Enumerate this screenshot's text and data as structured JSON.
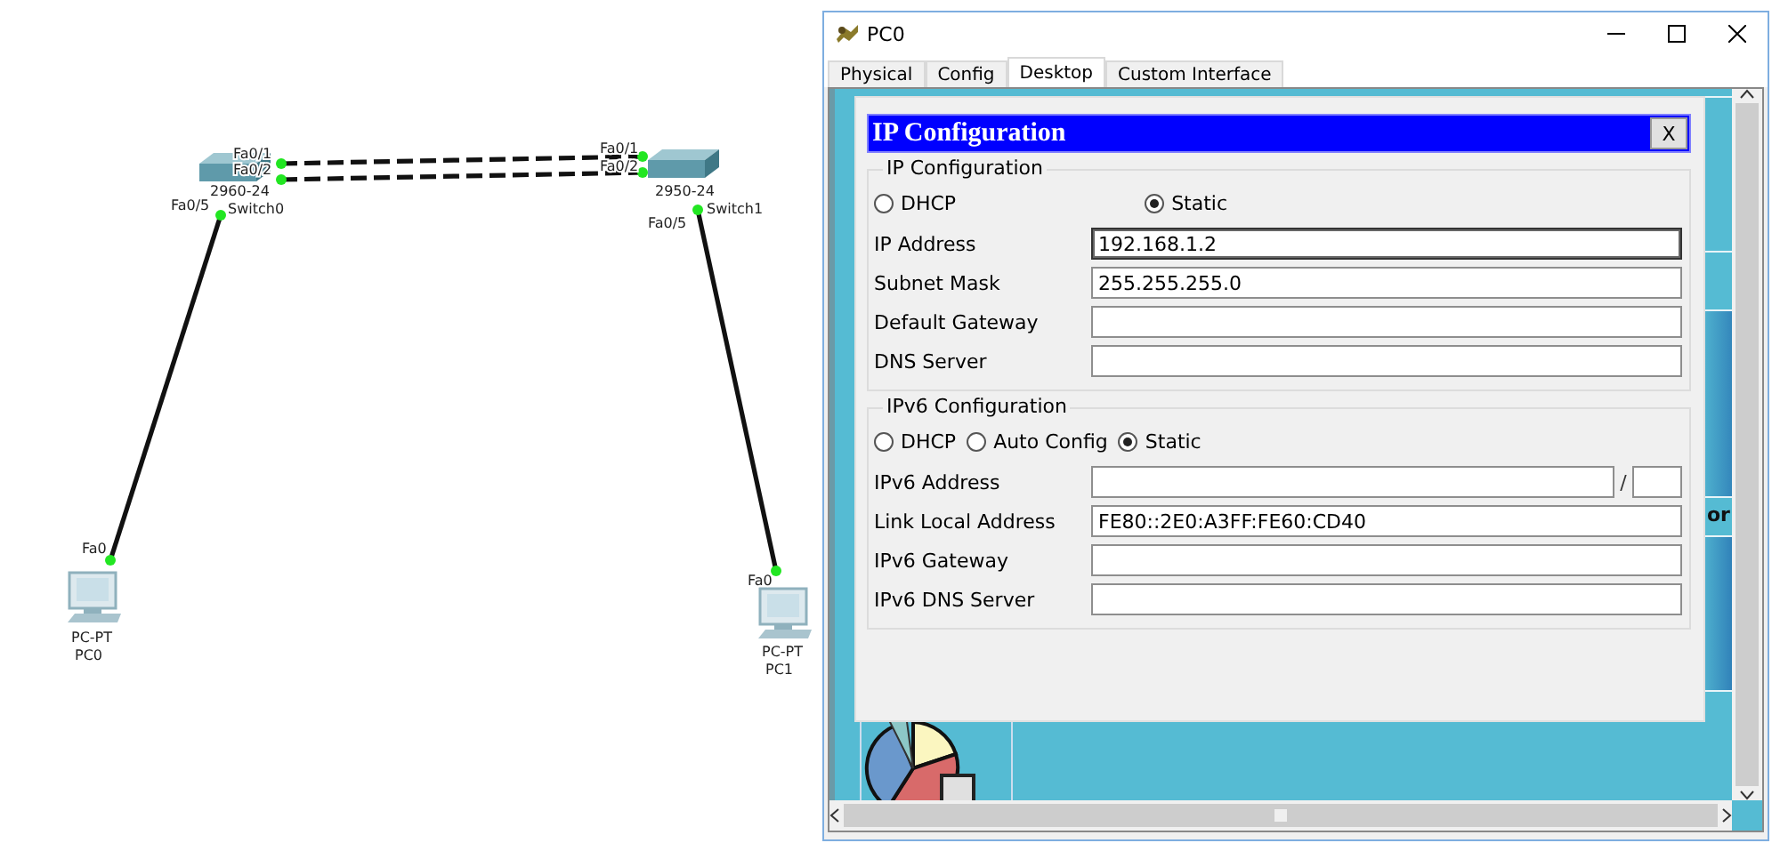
{
  "diagram": {
    "devices": [
      {
        "kind": "switch",
        "model": "2960-24",
        "name": "Switch0"
      },
      {
        "kind": "switch",
        "model": "2950-24",
        "name": "Switch1"
      },
      {
        "kind": "pc",
        "model": "PC-PT",
        "name": "PC0"
      },
      {
        "kind": "pc",
        "model": "PC-PT",
        "name": "PC1"
      }
    ],
    "links": [
      {
        "kind": "crossover",
        "ends": [
          "Fa0/1",
          "Fa0/1"
        ]
      },
      {
        "kind": "crossover",
        "ends": [
          "Fa0/2",
          "Fa0/2"
        ]
      },
      {
        "kind": "straight",
        "ends": [
          "Fa0/5",
          "Fa0"
        ]
      },
      {
        "kind": "straight",
        "ends": [
          "Fa0/5",
          "Fa0"
        ]
      }
    ]
  },
  "window": {
    "title": "PC0",
    "tabs": [
      {
        "label": "Physical",
        "selected": false
      },
      {
        "label": "Config",
        "selected": false
      },
      {
        "label": "Desktop",
        "selected": true
      },
      {
        "label": "Custom Interface",
        "selected": false
      }
    ],
    "desktop_fragment": "or",
    "dialog": {
      "title": "IP Configuration",
      "close": "X",
      "groups": [
        {
          "legend": "IP Configuration",
          "radios": [
            {
              "label": "DHCP",
              "selected": false
            },
            {
              "label": "Static",
              "selected": true
            }
          ],
          "fields": [
            {
              "kind": "text",
              "label": "IP Address",
              "value": "192.168.1.2",
              "focused": true
            },
            {
              "kind": "text",
              "label": "Subnet Mask",
              "value": "255.255.255.0",
              "focused": false
            },
            {
              "kind": "text",
              "label": "Default Gateway",
              "focused": false
            },
            {
              "kind": "text",
              "label": "DNS Server",
              "focused": false
            }
          ]
        },
        {
          "legend": "IPv6 Configuration",
          "radios": [
            {
              "label": "DHCP",
              "selected": false
            },
            {
              "label": "Auto Config",
              "selected": false
            },
            {
              "label": "Static",
              "selected": true
            }
          ],
          "fields": [
            {
              "kind": "prefixed",
              "label": "IPv6 Address",
              "separator": "/",
              "focused": false
            },
            {
              "kind": "text",
              "label": "Link Local Address",
              "value": "FE80::2E0:A3FF:FE60:CD40",
              "focused": false
            },
            {
              "kind": "text",
              "label": "IPv6 Gateway",
              "focused": false
            },
            {
              "kind": "text",
              "label": "IPv6 DNS Server",
              "focused": false
            }
          ]
        }
      ]
    }
  }
}
